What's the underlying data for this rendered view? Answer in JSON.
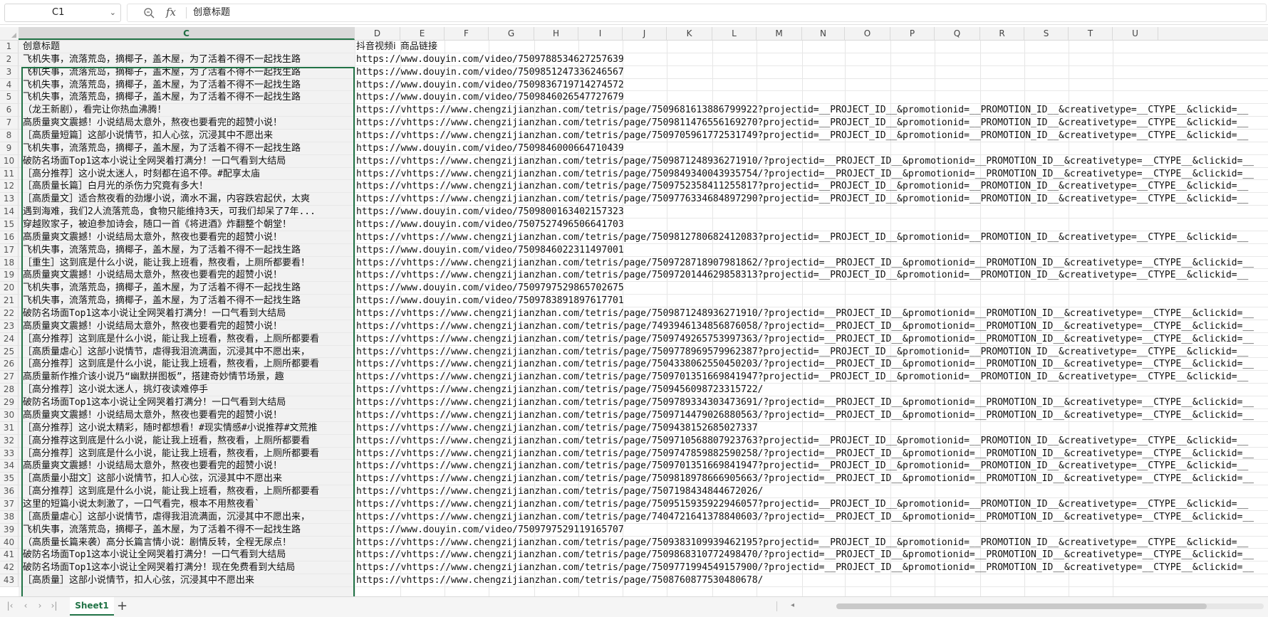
{
  "formula_bar": {
    "name_box": "C1",
    "fx_symbol": "fx",
    "content": "创意标题"
  },
  "columns": [
    "C",
    "D",
    "E",
    "F",
    "G",
    "H",
    "I",
    "J",
    "K",
    "L",
    "M",
    "N",
    "O",
    "P",
    "Q",
    "R",
    "S",
    "T",
    "U"
  ],
  "selected_column": "C",
  "header_row": {
    "row_num": "1",
    "c": "创意标题",
    "d1": "抖音视频i",
    "d2": "商品链接"
  },
  "rows": [
    {
      "n": "2",
      "c": "飞机失事，流落荒岛，摘椰子，盖木屋，为了活着不得不一起找生路",
      "d": "https://www.douyin.com/video/7509788534627257639"
    },
    {
      "n": "3",
      "c": "飞机失事，流落荒岛，摘椰子，盖木屋，为了活着不得不一起找生路",
      "d": "https://www.douyin.com/video/7509851247336246567"
    },
    {
      "n": "4",
      "c": "飞机失事，流落荒岛，摘椰子，盖木屋，为了活着不得不一起找生路",
      "d": "https://www.douyin.com/video/7509836719714274572"
    },
    {
      "n": "5",
      "c": "飞机失事，流落荒岛，摘椰子，盖木屋，为了活着不得不一起找生路",
      "d": "https://www.douyin.com/video/7509846026547727679"
    },
    {
      "n": "6",
      "c": "（龙王新剧），看完让你热血沸腾！",
      "d": "https://vhttps://www.chengzijianzhan.com/tetris/page/7509681613886799922?projectid=__PROJECT_ID__&promotionid=__PROMOTION_ID__&creativetype=__CTYPE__&clickid=__"
    },
    {
      "n": "7",
      "c": "高质量爽文震撼！小说结局太意外，熬夜也要看完的超赞小说！",
      "d": "https://vhttps://www.chengzijianzhan.com/tetris/page/7509811476556169270?projectid=__PROJECT_ID__&promotionid=__PROMOTION_ID__&creativetype=__CTYPE__&clickid=__"
    },
    {
      "n": "8",
      "c": "［高质量短篇］这部小说情节，扣人心弦，沉浸其中不愿出来",
      "d": "https://vhttps://www.chengzijianzhan.com/tetris/page/7509705961772531749?projectid=__PROJECT_ID__&promotionid=__PROMOTION_ID__&creativetype=__CTYPE__&clickid=__"
    },
    {
      "n": "9",
      "c": "飞机失事，流落荒岛，摘椰子，盖木屋，为了活着不得不一起找生路",
      "d": "https://www.douyin.com/video/7509846000664710439"
    },
    {
      "n": "10",
      "c": "破防名场面Top1这本小说让全网哭着打满分！一口气看到大结局",
      "d": "https://vhttps://www.chengzijianzhan.com/tetris/page/7509871248936271910/?projectid=__PROJECT_ID__&promotionid=__PROMOTION_ID__&creativetype=__CTYPE__&clickid=__"
    },
    {
      "n": "11",
      "c": "［高分推荐］这小说太迷人，时刻都在追不停。#配享太庙",
      "d": "https://vhttps://www.chengzijianzhan.com/tetris/page/7509849340043935754/?projectid=__PROJECT_ID__&promotionid=__PROMOTION_ID__&creativetype=__CTYPE__&clickid=__"
    },
    {
      "n": "12",
      "c": "［高质量长篇］白月光的杀伤力究竟有多大！",
      "d": "https://vhttps://www.chengzijianzhan.com/tetris/page/7509752358411255817?projectid=__PROJECT_ID__&promotionid=__PROMOTION_ID__&creativetype=__CTYPE__&clickid=__"
    },
    {
      "n": "13",
      "c": "［高质量文］适合熬夜看的劲爆小说，滴水不漏，内容跌宕起伏，太爽",
      "d": "https://vhttps://www.chengzijianzhan.com/tetris/page/7509776334684897290?projectid=__PROJECT_ID__&promotionid=__PROMOTION_ID__&creativetype=__CTYPE__&clickid=__"
    },
    {
      "n": "14",
      "c": "遇到海难，我们2人流落荒岛，食物只能维持3天，可我们却呆了7年...",
      "d": "https://www.douyin.com/video/7509800163402157323"
    },
    {
      "n": "15",
      "c": "穿越败家子，被迫参加诗会，随口一首《将进酒》炸翻整个朝堂！",
      "d": "https://www.douyin.com/video/7507527496506641703"
    },
    {
      "n": "16",
      "c": "高质量爽文震撼！小说结局太意外，熬夜也要看完的超赞小说！",
      "d": "https://vhttps://www.chengzijianzhan.com/tetris/page/7509812780682412083?projectid=__PROJECT_ID__&promotionid=__PROMOTION_ID__&creativetype=__CTYPE__&clickid=__"
    },
    {
      "n": "17",
      "c": "飞机失事，流落荒岛，摘椰子，盖木屋，为了活着不得不一起找生路",
      "d": "https://www.douyin.com/video/7509846022311497001"
    },
    {
      "n": "18",
      "c": "［重生］这到底是什么小说，能让我上班看，熬夜看，上厕所都要看！",
      "d": "https://vhttps://www.chengzijianzhan.com/tetris/page/7509728718907981862/?projectid=__PROJECT_ID__&promotionid=__PROMOTION_ID__&creativetype=__CTYPE__&clickid=__"
    },
    {
      "n": "19",
      "c": "高质量爽文震撼！小说结局太意外，熬夜也要看完的超赞小说！",
      "d": "https://vhttps://www.chengzijianzhan.com/tetris/page/7509720144629858313?projectid=__PROJECT_ID__&promotionid=__PROMOTION_ID__&creativetype=__CTYPE__&clickid=__"
    },
    {
      "n": "20",
      "c": "飞机失事，流落荒岛，摘椰子，盖木屋，为了活着不得不一起找生路",
      "d": "https://www.douyin.com/video/7509797529865702675"
    },
    {
      "n": "21",
      "c": "飞机失事，流落荒岛，摘椰子，盖木屋，为了活着不得不一起找生路",
      "d": "https://www.douyin.com/video/7509783891897617701"
    },
    {
      "n": "22",
      "c": "破防名场面Top1这本小说让全网哭着打满分！一口气看到大结局",
      "d": "https://vhttps://www.chengzijianzhan.com/tetris/page/7509871248936271910/?projectid=__PROJECT_ID__&promotionid=__PROMOTION_ID__&creativetype=__CTYPE__&clickid=__"
    },
    {
      "n": "23",
      "c": "高质量爽文震撼！小说结局太意外，熬夜也要看完的超赞小说！",
      "d": "https://vhttps://www.chengzijianzhan.com/tetris/page/7493946134856876058/?projectid=__PROJECT_ID__&promotionid=__PROMOTION_ID__&creativetype=__CTYPE__&clickid=__"
    },
    {
      "n": "24",
      "c": "［高分推荐］这到底是什么小说，能让我上班看，熬夜看，上厕所都要看",
      "d": "https://vhttps://www.chengzijianzhan.com/tetris/page/7509749265753997363/?projectid=__PROJECT_ID__&promotionid=__PROMOTION_ID__&creativetype=__CTYPE__&clickid=__"
    },
    {
      "n": "25",
      "c": "［高质量虐心］这部小说情节，虐得我泪流满面，沉浸其中不愿出来，",
      "d": "https://vhttps://www.chengzijianzhan.com/tetris/page/7509778969579962387?projectid=__PROJECT_ID__&promotionid=__PROMOTION_ID__&creativetype=__CTYPE__&clickid=__"
    },
    {
      "n": "26",
      "c": "［高分推荐］这到底是什么小说，能让我上班看，熬夜看，上厕所都要看",
      "d": "https://vhttps://www.chengzijianzhan.com/tetris/page/7504338062550450203/?projectid=__PROJECT_ID__&promotionid=__PROMOTION_ID__&creativetype=__CTYPE__&clickid=__"
    },
    {
      "n": "27",
      "c": "高质量新作推介该小说乃“幽默拼图板”，搭建奇妙情节场景，趣",
      "d": "https://vhttps://www.chengzijianzhan.com/tetris/page/7509701351669841947?projectid=__PROJECT_ID__&promotionid=__PROMOTION_ID__&creativetype=__CTYPE__&clickid=__"
    },
    {
      "n": "28",
      "c": "［高分推荐］这小说太迷人，挑灯夜读难停手",
      "d": "https://vhttps://www.chengzijianzhan.com/tetris/page/7509456098723315722/"
    },
    {
      "n": "29",
      "c": "破防名场面Top1这本小说让全网哭着打满分！一口气看到大结局",
      "d": "https://vhttps://www.chengzijianzhan.com/tetris/page/7509789334303473691/?projectid=__PROJECT_ID__&promotionid=__PROMOTION_ID__&creativetype=__CTYPE__&clickid=__"
    },
    {
      "n": "30",
      "c": "高质量爽文震撼！小说结局太意外，熬夜也要看完的超赞小说！",
      "d": "https://vhttps://www.chengzijianzhan.com/tetris/page/7509714479026880563/?projectid=__PROJECT_ID__&promotionid=__PROMOTION_ID__&creativetype=__CTYPE__&clickid=__"
    },
    {
      "n": "31",
      "c": "［高分推荐］这小说太精彩，随时都想看！#现实情感#小说推荐#文荒推",
      "d": "https://vhttps://www.chengzijianzhan.com/tetris/page/7509438152685027337"
    },
    {
      "n": "32",
      "c": "［高分推荐这到底是什么小说，能让我上班看，熬夜看，上厕所都要看",
      "d": "https://vhttps://www.chengzijianzhan.com/tetris/page/7509710568807923763?projectid=__PROJECT_ID__&promotionid=__PROMOTION_ID__&creativetype=__CTYPE__&clickid=__"
    },
    {
      "n": "33",
      "c": "［高分推荐］这到底是什么小说，能让我上班看，熬夜看，上厕所都要看",
      "d": "https://vhttps://www.chengzijianzhan.com/tetris/page/7509747859882590258/?projectid=__PROJECT_ID__&promotionid=__PROMOTION_ID__&creativetype=__CTYPE__&clickid=__"
    },
    {
      "n": "34",
      "c": "高质量爽文震撼！小说结局太意外，熬夜也要看完的超赞小说！",
      "d": "https://vhttps://www.chengzijianzhan.com/tetris/page/7509701351669841947?projectid=__PROJECT_ID__&promotionid=__PROMOTION_ID__&creativetype=__CTYPE__&clickid=__"
    },
    {
      "n": "35",
      "c": "［高质量小甜文］这部小说情节，扣人心弦，沉浸其中不愿出来",
      "d": "https://vhttps://www.chengzijianzhan.com/tetris/page/7509818978666905663/?projectid=__PROJECT_ID__&promotionid=__PROMOTION_ID__&creativetype=__CTYPE__&clickid=__"
    },
    {
      "n": "36",
      "c": "［高分推荐］这到底是什么小说，能让我上班看，熬夜看，上厕所都要看",
      "d": "https://vhttps://www.chengzijianzhan.com/tetris/page/7507198434844672026/"
    },
    {
      "n": "37",
      "c": "这里的短篇小说太刺激了，一口气看完，根本不用熬夜看`",
      "d": "https://vhttps://www.chengzijianzhan.com/tetris/page/7509515935922946057?projectid=__PROJECT_ID__&promotionid=__PROMOTION_ID__&creativetype=__CTYPE__&clickid=__"
    },
    {
      "n": "38",
      "c": "［高质量虐心］这部小说情节，虐得我泪流满面，沉浸其中不愿出来，",
      "d": "https://vhttps://www.chengzijianzhan.com/tetris/page/7404721641378840603/?projectid=__PROJECT_ID__&promotionid=__PROMOTION_ID__&creativetype=__CTYPE__&clickid=__"
    },
    {
      "n": "39",
      "c": "飞机失事，流落荒岛，摘椰子，盖木屋，为了活着不得不一起找生路",
      "d": "https://www.douyin.com/video/7509797529119165707"
    },
    {
      "n": "40",
      "c": "（高质量长篇来袭）高分长篇言情小说：剧情反转，全程无尿点！",
      "d": "https://vhttps://www.chengzijianzhan.com/tetris/page/7509383109939462195?projectid=__PROJECT_ID__&promotionid=__PROMOTION_ID__&creativetype=__CTYPE__&clickid=__"
    },
    {
      "n": "41",
      "c": "破防名场面Top1这本小说让全网哭着打满分！一口气看到大结局",
      "d": "https://vhttps://www.chengzijianzhan.com/tetris/page/7509868310772498470/?projectid=__PROJECT_ID__&promotionid=__PROMOTION_ID__&creativetype=__CTYPE__&clickid=__"
    },
    {
      "n": "42",
      "c": "破防名场面Top1这本小说让全网哭着打满分！现在免费看到大结局",
      "d": "https://vhttps://www.chengzijianzhan.com/tetris/page/7509771994549157900/?projectid=__PROJECT_ID__&promotionid=__PROMOTION_ID__&creativetype=__CTYPE__&clickid=__"
    },
    {
      "n": "43",
      "c": "［高质量］这部小说情节，扣人心弦，沉浸其中不愿出来",
      "d": "https://vhttps://www.chengzijianzhan.com/tetris/page/7508760877530480678/"
    }
  ],
  "tab_bar": {
    "nav_first": "|‹",
    "nav_prev": "‹",
    "nav_next": "›",
    "nav_last": "›|",
    "sheet_name": "Sheet1",
    "add_sheet": "+",
    "hscroll_left": "◂"
  },
  "colors": {
    "selection": "#217346",
    "header_bg": "#f3f3f3"
  }
}
